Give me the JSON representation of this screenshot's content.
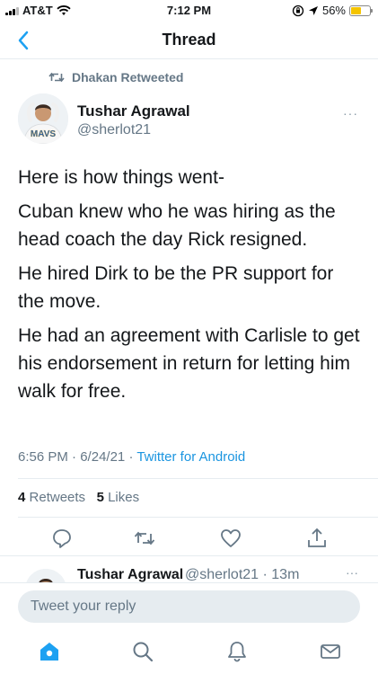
{
  "status_bar": {
    "carrier": "AT&T",
    "time": "7:12 PM",
    "battery": "56%",
    "battery_level": 0.56
  },
  "header": {
    "title": "Thread"
  },
  "tweet": {
    "retweeted_by": "Dhakan Retweeted",
    "avatar_text": "MAVS",
    "author_name": "Tushar Agrawal",
    "author_handle": "@sherlot21",
    "more": "···",
    "paragraphs": [
      "Here is how things went-",
      "Cuban knew who he was hiring as the head coach the day Rick resigned.",
      "He hired Dirk to be the PR support for the move.",
      "He had an agreement with Carlisle to get his endorsement in return for letting him walk for free."
    ],
    "time": "6:56 PM",
    "date": "6/24/21",
    "source": "Twitter for Android",
    "retweets_count": "4",
    "retweets_label": "Retweets",
    "likes_count": "5",
    "likes_label": "Likes"
  },
  "next_tweet": {
    "author_name": "Tushar Agrawal",
    "author_handle": "@sherlot21 · 13m",
    "more": "···"
  },
  "reply": {
    "placeholder": "Tweet your reply"
  },
  "icons": {
    "accent": "#1da1f2",
    "action_color": "#657786"
  }
}
